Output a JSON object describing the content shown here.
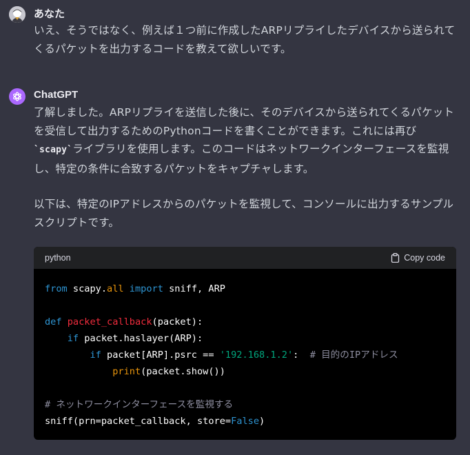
{
  "user_message": {
    "author": "あなた",
    "text": "いえ、そうではなく、例えば１つ前に作成したARPリプライしたデバイスから送られてくるパケットを出力するコードを教えて欲しいです。"
  },
  "assistant_message": {
    "author": "ChatGPT",
    "p1_part1": "了解しました。ARPリプライを送信した後に、そのデバイスから送られてくるパケットを受信して出力するためのPythonコードを書くことができます。これには再び",
    "p1_code": "`scapy`",
    "p1_part2": "ライブラリを使用します。このコードはネットワークインターフェースを監視し、特定の条件に合致するパケットをキャプチャします。",
    "p2": "以下は、特定のIPアドレスからのパケットを監視して、コンソールに出力するサンプルスクリプトです。"
  },
  "code_block": {
    "language": "python",
    "copy_label": "Copy code",
    "tokens": {
      "from": "from",
      "mod": " scapy.",
      "all": "all",
      "import": "import",
      "imports": " sniff, ARP",
      "def": "def",
      "fname": "packet_callback",
      "params": "(packet):",
      "if1": "if",
      "cond1": " packet.haslayer(ARP):",
      "if2": "if",
      "cond2": " packet[ARP].psrc == ",
      "ip": "'192.168.1.2'",
      "colon": ":  ",
      "comment1": "# 目的のIPアドレス",
      "print": "print",
      "print_args": "(packet.show())",
      "comment2": "# ネットワークインターフェースを監視する",
      "sniff_call": "sniff(prn=packet_callback, store=",
      "false": "False",
      "close": ")"
    }
  },
  "colors": {
    "background": "#343541",
    "code_background": "#000000",
    "code_header": "#202123",
    "assistant_avatar": "#ab68ff"
  },
  "icons": [
    "user-avatar",
    "chatgpt-logo-icon",
    "clipboard-icon"
  ]
}
